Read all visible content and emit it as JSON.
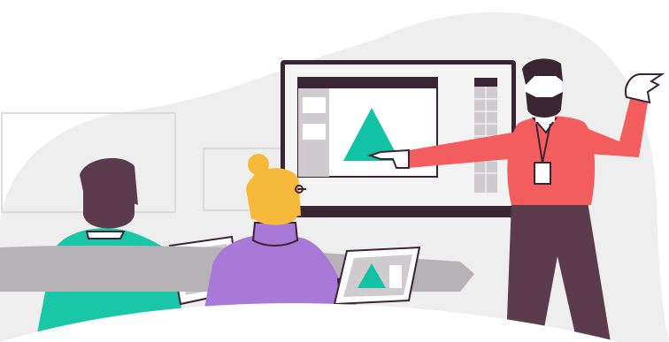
{
  "illustration": {
    "kind": "presentation-scene",
    "colors": {
      "background": "#ffffff",
      "blob": "#eeeeee",
      "wall_frame": "#dcdcdc",
      "outline": "#3b2433",
      "screen_frame": "#3a2532",
      "screen_bg": "#f3f3f3",
      "app_sidebar": "#cfcbce",
      "app_panel": "#cfcbce",
      "shape_teal": "#12c2a6",
      "presenter_shirt": "#f45d5d",
      "presenter_pants": "#5b3b4c",
      "presenter_hair": "#3a2532",
      "skin": "#ffffff",
      "listener1_shirt": "#19c7a8",
      "listener1_hair": "#5b3b4c",
      "listener2_shirt": "#a979d8",
      "listener2_hair": "#f6b93b",
      "tablet_body": "#ffffff",
      "tablet_screen": "#cfcbce",
      "table": "#b7b2b6"
    }
  }
}
